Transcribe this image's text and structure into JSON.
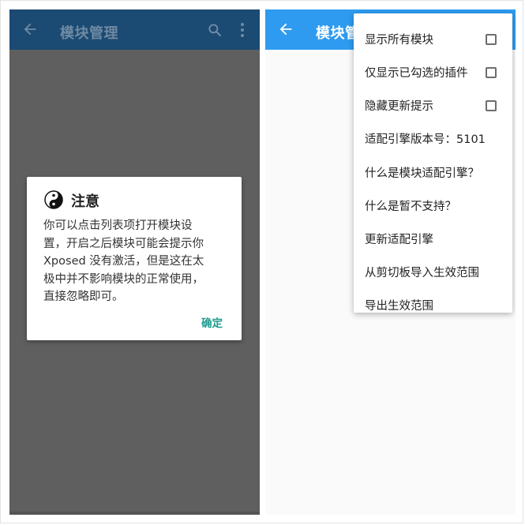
{
  "left_screen": {
    "toolbar": {
      "title": "模块管理"
    },
    "dialog": {
      "title": "注意",
      "body_lines": [
        "你可以点击列表项打开模块设",
        "置，开启之后模块可能会提示你",
        "Xposed 没有激活，但是这在太",
        "极中并不影响模块的正常使用，",
        "直接忽略即可。"
      ],
      "ok_label": "确定"
    }
  },
  "right_screen": {
    "toolbar": {
      "title": "模块管"
    },
    "menu": {
      "items": [
        {
          "label": "显示所有模块",
          "checkbox": true,
          "checked": false
        },
        {
          "label": "仅显示已勾选的插件",
          "checkbox": true,
          "checked": false
        },
        {
          "label": "隐藏更新提示",
          "checkbox": true,
          "checked": false
        },
        {
          "label": "适配引擎版本号：5101",
          "checkbox": false
        },
        {
          "label": "什么是模块适配引擎？",
          "checkbox": false
        },
        {
          "label": "什么是暂不支持？",
          "checkbox": false
        },
        {
          "label": "更新适配引擎",
          "checkbox": false
        },
        {
          "label": "从剪切板导入生效范围",
          "checkbox": false
        },
        {
          "label": "导出生效范围",
          "checkbox": false
        }
      ]
    }
  },
  "colors": {
    "left_toolbar": "#1b4a73",
    "left_scrim": "#5f5f5f",
    "right_toolbar": "#2e9bf0",
    "dialog_button": "#1f9b8e"
  }
}
